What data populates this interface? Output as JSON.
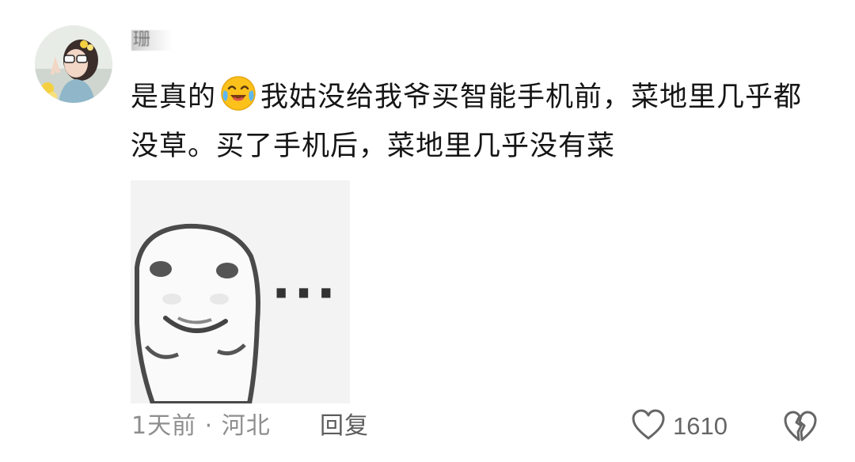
{
  "comment": {
    "username": "珊",
    "text_before_emoji": "是真的",
    "emoji": "crying-laughing-emoji",
    "text_after_emoji": "我姑没给我爷买智能手机前，菜地里几乎都没草。买了手机后，菜地里几乎没有菜",
    "sticker_dots": "···",
    "time_location": "1天前 · 河北",
    "reply_label": "回复",
    "like_count": "1610",
    "icons": [
      "heart-icon",
      "broken-heart-icon"
    ]
  }
}
